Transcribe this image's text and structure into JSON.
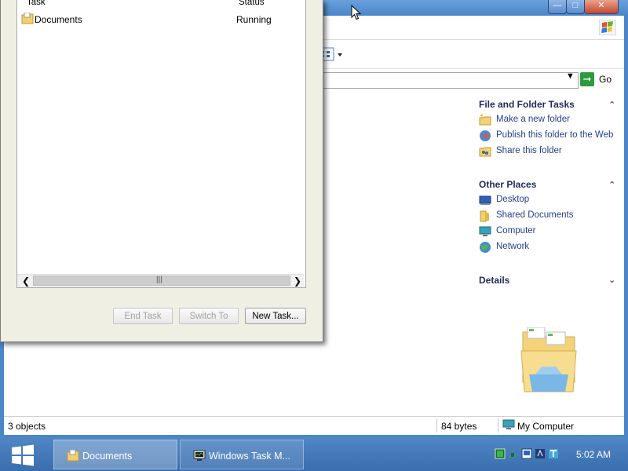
{
  "explorer": {
    "go_label": "Go",
    "task_pane": {
      "file_folder_tasks": {
        "header": "File and Folder Tasks",
        "items": [
          {
            "label": "Make a new folder",
            "icon": "new-folder-icon"
          },
          {
            "label": "Publish this folder to the Web",
            "icon": "publish-web-icon"
          },
          {
            "label": "Share this folder",
            "icon": "share-folder-icon"
          }
        ]
      },
      "other_places": {
        "header": "Other Places",
        "items": [
          {
            "label": "Desktop",
            "icon": "desktop-icon"
          },
          {
            "label": "Shared Documents",
            "icon": "folder-icon"
          },
          {
            "label": "Computer",
            "icon": "computer-icon"
          },
          {
            "label": "Network",
            "icon": "network-icon"
          }
        ]
      },
      "details": {
        "header": "Details"
      }
    },
    "status": {
      "objects": "3 objects",
      "size": "84 bytes",
      "location": "My Computer"
    }
  },
  "task_manager": {
    "columns": {
      "task": "Task",
      "status": "Status"
    },
    "rows": [
      {
        "task": "Documents",
        "status": "Running"
      }
    ],
    "buttons": {
      "end_task": "End Task",
      "switch_to": "Switch To",
      "new_task": "New Task..."
    }
  },
  "taskbar": {
    "tasks": [
      {
        "label": "Documents",
        "active": true
      },
      {
        "label": "Windows Task M...",
        "active": false
      }
    ],
    "clock": "5:02 AM"
  },
  "colors": {
    "desktop": "#3f72b4",
    "task_link": "#26408c",
    "task_header": "#1e2a5a"
  }
}
